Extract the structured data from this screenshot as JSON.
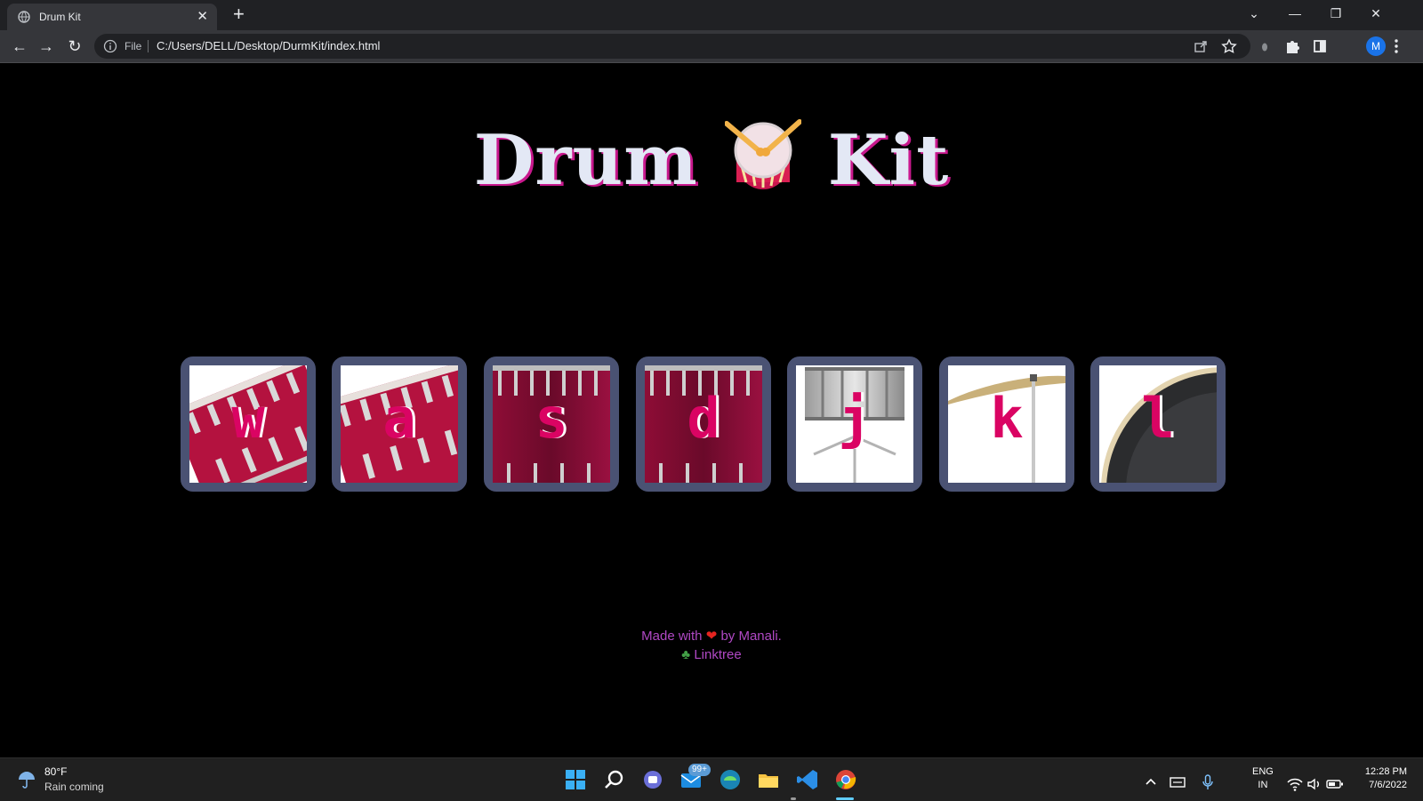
{
  "browser": {
    "tab_title": "Drum Kit",
    "tab_close": "✕",
    "new_tab": "+",
    "file_label": "File",
    "url": "C:/Users/DELL/Desktop/DurmKit/index.html",
    "avatar_initial": "M",
    "controls": {
      "tab_search": "⌄",
      "minimize": "—",
      "restore": "❐",
      "close": "✕"
    },
    "nav": {
      "back": "←",
      "forward": "→",
      "reload": "↻"
    }
  },
  "page": {
    "heading_left": "Drum",
    "heading_right": "Kit",
    "drums": [
      {
        "key": "w",
        "kind": "tom"
      },
      {
        "key": "a",
        "kind": "tom"
      },
      {
        "key": "s",
        "kind": "bass"
      },
      {
        "key": "d",
        "kind": "bass"
      },
      {
        "key": "j",
        "kind": "snare"
      },
      {
        "key": "k",
        "kind": "crash"
      },
      {
        "key": "l",
        "kind": "kick"
      }
    ],
    "footer": {
      "made_with": "Made with",
      "heart": "❤",
      "by": "by Manali.",
      "tree_icon": "♣",
      "link": "Linktree"
    }
  },
  "taskbar": {
    "temperature": "80°F",
    "condition": "Rain coming",
    "mail_badge": "99+",
    "language_top": "ENG",
    "language_bottom": "IN",
    "time": "12:28 PM",
    "date": "7/6/2022"
  },
  "colors": {
    "drum_border": "#4a5273",
    "key_letter": "#da0463",
    "heading": "#e3e8f5",
    "footer_text": "#b048c4"
  }
}
